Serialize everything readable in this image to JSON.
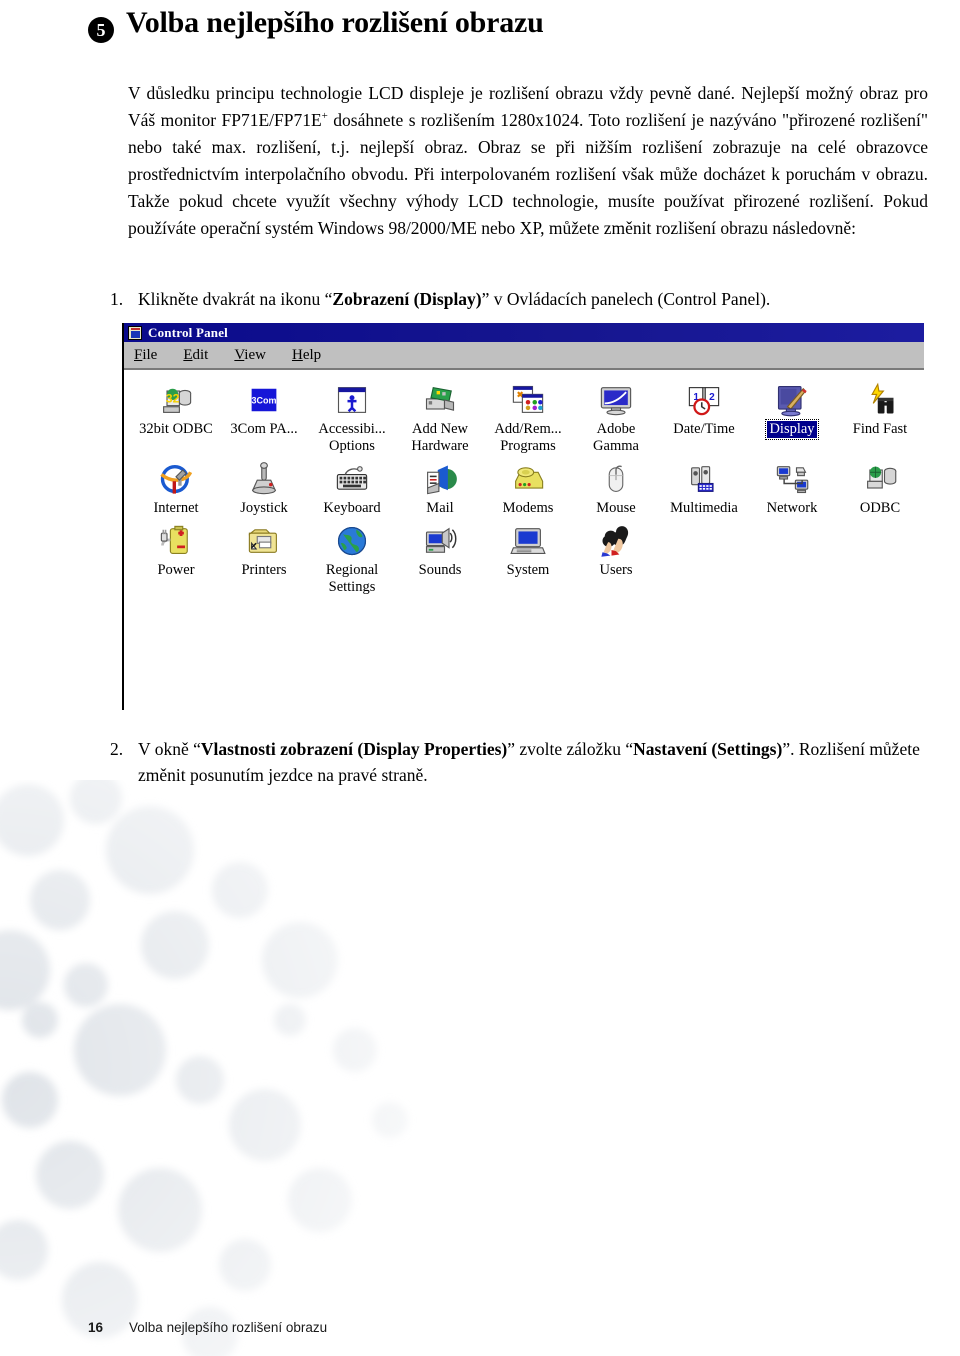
{
  "page": {
    "bullet": "5",
    "title": "Volba nejlepšího rozlišení obrazu",
    "intro_part1": "V důsledku principu technologie LCD displeje je rozlišení obrazu vždy pevně dané. Nejlepší možný obraz pro Váš monitor FP71E/FP71E",
    "intro_sup": "+",
    "intro_part2": " dosáhnete s rozlišením 1280x1024. Toto rozlišení je nazýváno \"přirozené rozlišení\" nebo také max. rozlišení, t.j. nejlepší obraz. Obraz se při nižším rozlišení zobrazuje na celé obrazovce prostřednictvím interpolačního obvodu. Při interpolovaném rozlišení však může docházet k poruchám v obrazu. Takže pokud chcete využít všechny výhody LCD technologie, musíte používat přirozené rozlišení. Pokud používáte operační systém Windows 98/2000/ME nebo XP, můžete změnit rozlišení obrazu následovně:"
  },
  "steps": [
    {
      "num": "1.",
      "pre": "Klikněte dvakrát na ikonu “",
      "bold": "Zobrazení (Display)",
      "post": "” v Ovládacích panelech (Control Panel)."
    },
    {
      "num": "2.",
      "pre": "V okně “",
      "bold": "Vlastnosti zobrazení (Display Properties)",
      "mid": "” zvolte záložku “",
      "bold2": "Nastavení (Settings)",
      "post": "”. Rozlišení můžete změnit posunutím jezdce na pravé straně."
    }
  ],
  "control_panel": {
    "window_title": "Control Panel",
    "title_icon": "control-panel-icon",
    "menu": [
      {
        "label": "File",
        "accel": "F",
        "rest": "ile"
      },
      {
        "label": "Edit",
        "accel": "E",
        "rest": "dit"
      },
      {
        "label": "View",
        "accel": "V",
        "rest": "iew"
      },
      {
        "label": "Help",
        "accel": "H",
        "rest": "elp"
      }
    ],
    "selected_item": "Display",
    "rows": [
      [
        {
          "name": "32bit-odbc",
          "label": "32bit ODBC",
          "icon": "odbc-32bit-icon"
        },
        {
          "name": "3com-pa",
          "label": "3Com PA...",
          "icon": "3com-icon"
        },
        {
          "name": "accessibility-options",
          "label": "Accessibi... Options",
          "icon": "accessibility-icon"
        },
        {
          "name": "add-new-hardware",
          "label": "Add New Hardware",
          "icon": "add-new-hardware-icon"
        },
        {
          "name": "add-remove-programs",
          "label": "Add/Rem... Programs",
          "icon": "add-remove-programs-icon"
        },
        {
          "name": "adobe-gamma",
          "label": "Adobe Gamma",
          "icon": "adobe-gamma-icon"
        },
        {
          "name": "date-time",
          "label": "Date/Time",
          "icon": "date-time-icon"
        },
        {
          "name": "display",
          "label": "Display",
          "icon": "display-icon"
        },
        {
          "name": "find-fast",
          "label": "Find Fast",
          "icon": "find-fast-icon"
        }
      ],
      [
        {
          "name": "internet",
          "label": "Internet",
          "icon": "internet-icon"
        },
        {
          "name": "joystick",
          "label": "Joystick",
          "icon": "joystick-icon"
        },
        {
          "name": "keyboard",
          "label": "Keyboard",
          "icon": "keyboard-icon"
        },
        {
          "name": "mail",
          "label": "Mail",
          "icon": "mail-icon"
        },
        {
          "name": "modems",
          "label": "Modems",
          "icon": "modems-icon"
        },
        {
          "name": "mouse",
          "label": "Mouse",
          "icon": "mouse-icon"
        },
        {
          "name": "multimedia",
          "label": "Multimedia",
          "icon": "multimedia-icon"
        },
        {
          "name": "network",
          "label": "Network",
          "icon": "network-icon"
        },
        {
          "name": "odbc",
          "label": "ODBC",
          "icon": "odbc-icon"
        }
      ],
      [
        {
          "name": "power",
          "label": "Power",
          "icon": "power-icon"
        },
        {
          "name": "printers",
          "label": "Printers",
          "icon": "printers-icon"
        },
        {
          "name": "regional-settings",
          "label": "Regional Settings",
          "icon": "regional-settings-icon"
        },
        {
          "name": "sounds",
          "label": "Sounds",
          "icon": "sounds-icon"
        },
        {
          "name": "system",
          "label": "System",
          "icon": "system-icon"
        },
        {
          "name": "users",
          "label": "Users",
          "icon": "users-icon"
        }
      ]
    ]
  },
  "footer": {
    "page_number": "16",
    "chapter": "Volba nejlepšího rozlišení obrazu"
  },
  "colors": {
    "titlebar_blue": "#0a0a8c",
    "selection_blue": "#00008b",
    "window_gray": "#c0c0c0"
  }
}
